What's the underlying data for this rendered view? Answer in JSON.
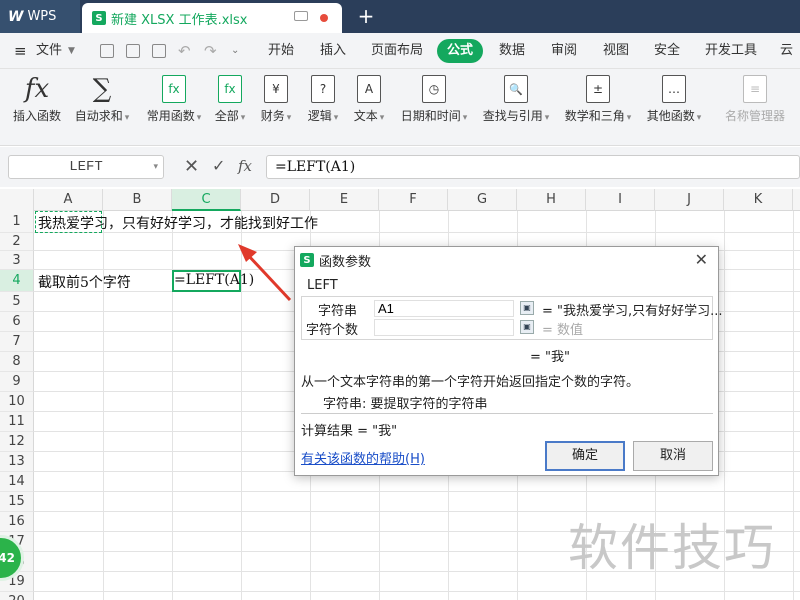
{
  "titlebar": {
    "app_tab": "WPS",
    "app_logo": "W",
    "doc_tab": "新建 XLSX 工作表.xlsx",
    "doc_logo": "S",
    "new_tab": "+"
  },
  "menubar": {
    "file": "文件",
    "items": [
      "开始",
      "插入",
      "页面布局",
      "公式",
      "数据",
      "审阅",
      "视图",
      "安全",
      "开发工具",
      "云服"
    ],
    "active": "公式"
  },
  "ribbon": {
    "buttons": [
      {
        "label": "插入函数",
        "icon": "fx-icon",
        "glyph": "fx"
      },
      {
        "label": "自动求和",
        "icon": "sigma-icon",
        "glyph": "∑"
      },
      {
        "label": "常用函数",
        "icon": "star-fx-icon",
        "glyph": "fx"
      },
      {
        "label": "全部",
        "icon": "all-fx-icon",
        "glyph": "fx"
      },
      {
        "label": "财务",
        "icon": "finance-icon",
        "glyph": "¥"
      },
      {
        "label": "逻辑",
        "icon": "logic-icon",
        "glyph": "?"
      },
      {
        "label": "文本",
        "icon": "text-icon",
        "glyph": "A"
      },
      {
        "label": "日期和时间",
        "icon": "clock-icon",
        "glyph": "◷"
      },
      {
        "label": "查找与引用",
        "icon": "lookup-icon",
        "glyph": "🔍"
      },
      {
        "label": "数学和三角",
        "icon": "math-icon",
        "glyph": "±"
      },
      {
        "label": "其他函数",
        "icon": "more-icon",
        "glyph": "…"
      },
      {
        "label": "名称管理器",
        "icon": "name-manager-icon",
        "glyph": "≡"
      }
    ]
  },
  "formula_bar": {
    "name_box": "LEFT",
    "cancel": "✕",
    "confirm": "✓",
    "fx": "fx",
    "formula": "=LEFT(A1)"
  },
  "sheet": {
    "columns": [
      "A",
      "B",
      "C",
      "D",
      "E",
      "F",
      "G",
      "H",
      "I",
      "J",
      "K"
    ],
    "selected_column": "C",
    "rows": [
      "1",
      "2",
      "3",
      "4",
      "5",
      "6",
      "7",
      "8",
      "9",
      "10",
      "11",
      "12",
      "13",
      "14",
      "15",
      "16",
      "17",
      "18",
      "19",
      "20"
    ],
    "selected_row": "4",
    "a1": "我热爱学习，只有好好学习，才能找到好工作",
    "a4": "截取前5个字符",
    "c4": "=LEFT(A1)"
  },
  "dialog": {
    "title": "函数参数",
    "logo": "S",
    "close": "✕",
    "function": "LEFT",
    "arg1_label": "字符串",
    "arg1_value": "A1",
    "arg1_result": "= \"我热爱学习,只有好好学习...",
    "arg2_label": "字符个数",
    "arg2_value": "",
    "arg2_result": "= 数值",
    "result_preview": "= \"我\"",
    "description": "从一个文本字符串的第一个字符开始返回指定个数的字符。",
    "arg_description": "字符串: 要提取字符的字符串",
    "calc_result": "计算结果 = \"我\"",
    "help_link": "有关该函数的帮助(H)",
    "ok": "确定",
    "cancel": "取消"
  },
  "watermark": "软件技巧",
  "badge": "42",
  "colors": {
    "accent": "#14a85e",
    "titlebar": "#2b3e5a",
    "arrow": "#e0392b",
    "link": "#1a4ec8"
  }
}
